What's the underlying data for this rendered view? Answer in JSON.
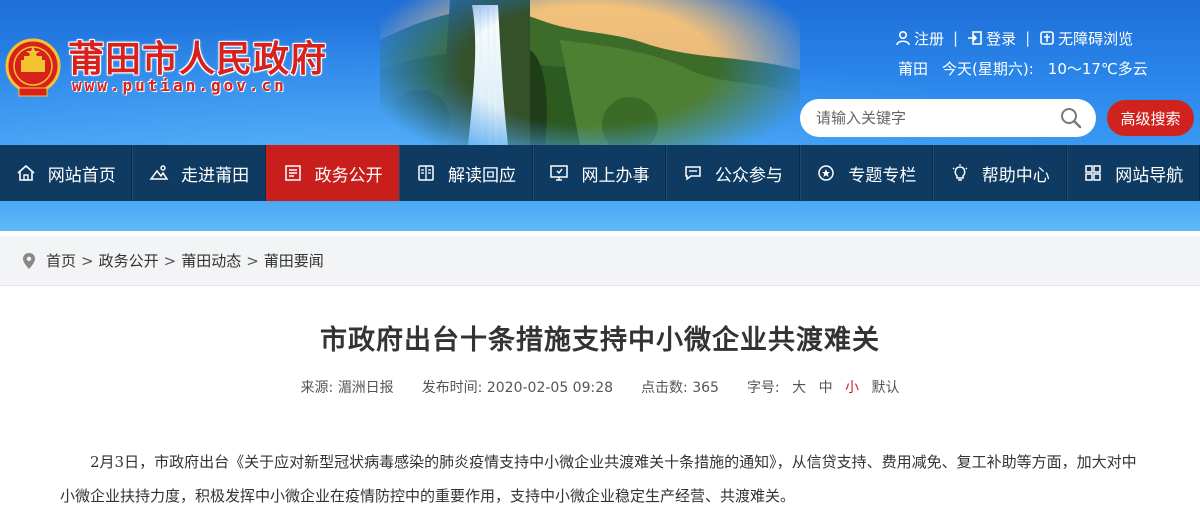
{
  "header": {
    "site_name": "莆田市人民政府",
    "site_url": "www.putian.gov.cn",
    "links": {
      "register": "注册",
      "login": "登录",
      "accessible": "无障碍浏览",
      "sep": "|"
    },
    "weather": {
      "city": "莆田",
      "day": "今天(星期六):",
      "forecast": "10～17℃多云"
    },
    "search": {
      "placeholder": "请输入关键字"
    },
    "advanced_search": "高级搜索"
  },
  "nav": [
    {
      "label": "网站首页",
      "icon": "home-icon"
    },
    {
      "label": "走进莆田",
      "icon": "landscape-icon"
    },
    {
      "label": "政务公开",
      "icon": "document-icon",
      "active": true
    },
    {
      "label": "解读回应",
      "icon": "book-icon"
    },
    {
      "label": "网上办事",
      "icon": "monitor-icon"
    },
    {
      "label": "公众参与",
      "icon": "chat-icon"
    },
    {
      "label": "专题专栏",
      "icon": "badge-icon"
    },
    {
      "label": "帮助中心",
      "icon": "lightbulb-icon"
    },
    {
      "label": "网站导航",
      "icon": "grid-icon"
    }
  ],
  "breadcrumb": [
    "首页",
    "政务公开",
    "莆田动态",
    "莆田要闻"
  ],
  "breadcrumb_sep": ">",
  "article": {
    "title": "市政府出台十条措施支持中小微企业共渡难关",
    "meta": {
      "source_label": "来源:",
      "source": "湄洲日报",
      "time_label": "发布时间:",
      "time": "2020-02-05 09:28",
      "clicks_label": "点击数:",
      "clicks": "365",
      "font_label": "字号:",
      "sizes": [
        "大",
        "中",
        "小",
        "默认"
      ]
    },
    "body": "2月3日，市政府出台《关于应对新型冠状病毒感染的肺炎疫情支持中小微企业共渡难关十条措施的通知》，从信贷支持、费用减免、复工补助等方面，加大对中小微企业扶持力度，积极发挥中小微企业在疫情防控中的重要作用，支持中小微企业稳定生产经营、共渡难关。"
  },
  "colors": {
    "header_blue": "#2a86ea",
    "nav_bg": "#0f3b63",
    "accent_red": "#d0231f"
  }
}
